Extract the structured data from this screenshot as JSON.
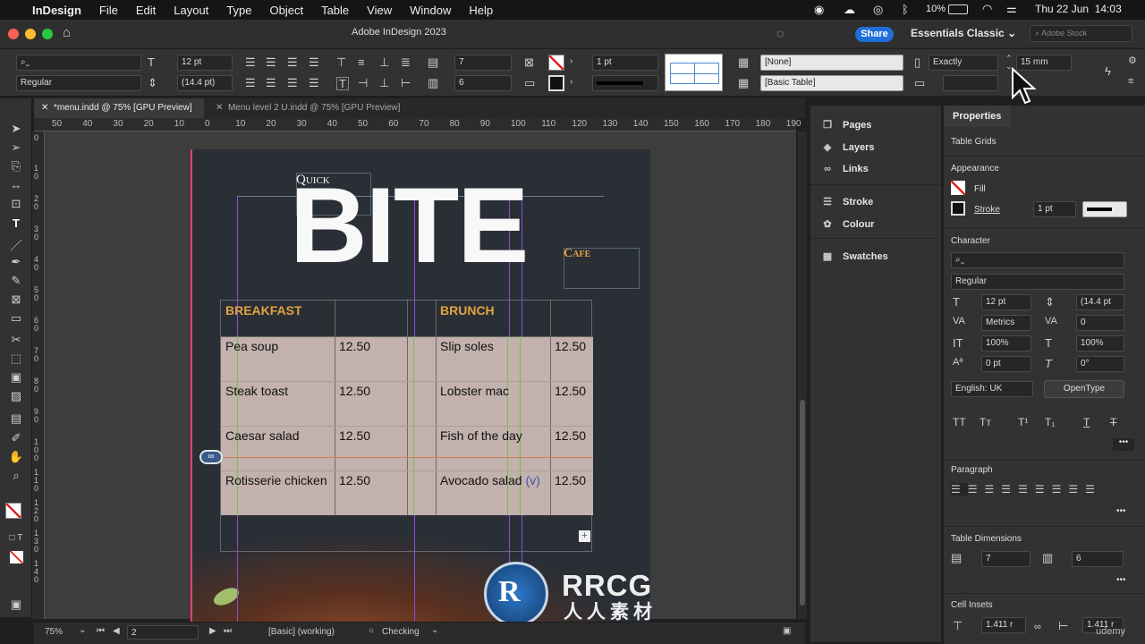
{
  "menubar": {
    "app": "InDesign",
    "items": [
      "File",
      "Edit",
      "Layout",
      "Type",
      "Object",
      "Table",
      "View",
      "Window",
      "Help"
    ],
    "battery": "10%",
    "datetime": "Thu 22 Jun  14:03"
  },
  "titlebar": {
    "title": "Adobe InDesign 2023",
    "share": "Share",
    "workspace": "Essentials Classic",
    "stock_placeholder": "Adobe Stock"
  },
  "control": {
    "font_size": "12 pt",
    "font_style": "Regular",
    "leading": "(14.4 pt)",
    "rows": "7",
    "cols": "6",
    "stroke_weight": "1 pt",
    "cell_style": "[None]",
    "table_style": "[Basic Table]",
    "row_height_mode": "Exactly",
    "row_height": "15 mm"
  },
  "tabs": [
    {
      "label": "*menu.indd @ 75% [GPU Preview]"
    },
    {
      "label": "Menu level 2 U.indd @ 75% [GPU Preview]"
    }
  ],
  "ruler_h": [
    "50",
    "40",
    "30",
    "20",
    "10",
    "0",
    "10",
    "20",
    "30",
    "40",
    "50",
    "60",
    "70",
    "80",
    "90",
    "100",
    "110",
    "120",
    "130",
    "140",
    "150",
    "160",
    "170",
    "180",
    "190"
  ],
  "ruler_v": [
    "0",
    "1\n0",
    "2\n0",
    "3\n0",
    "4\n0",
    "5\n0",
    "6\n0",
    "7\n0",
    "8\n0",
    "9\n0",
    "1\n0\n0",
    "1\n1\n0",
    "1\n2\n0",
    "1\n3\n0",
    "1\n4\n0"
  ],
  "document": {
    "quick": "Quick",
    "bite": "BITE",
    "cafe": "Cafe",
    "breakfast_header": "BREAKFAST",
    "brunch_header": "BRUNCH",
    "rows": [
      {
        "item1": "Pea soup",
        "price1": "12.50",
        "item2": "Slip soles",
        "price2": "12.50",
        "tag2": ""
      },
      {
        "item1": "Steak toast",
        "price1": "12.50",
        "item2": "Lobster mac",
        "price2": "12.50",
        "tag2": ""
      },
      {
        "item1": "Caesar salad",
        "price1": "12.50",
        "item2": "Fish of the day",
        "price2": "12.50",
        "tag2": ""
      },
      {
        "item1": "Rotisserie chicken",
        "price1": "12.50",
        "item2": "Avocado salad",
        "price2": "12.50",
        "tag2": "(v)"
      }
    ],
    "header_color": "#e0a341",
    "cell_fill": "#c2b1ac",
    "page_bg": "#2a2f36"
  },
  "statusbar": {
    "zoom": "75%",
    "page": "2",
    "style": "[Basic] (working)",
    "preflight": "Checking"
  },
  "panels_left": {
    "items": [
      "Pages",
      "Layers",
      "Links",
      "Stroke",
      "Colour",
      "Swatches"
    ]
  },
  "properties": {
    "tab": "Properties",
    "context": "Table Grids",
    "appearance": "Appearance",
    "fill": "Fill",
    "stroke": "Stroke",
    "stroke_weight": "1 pt",
    "character": "Character",
    "font_style": "Regular",
    "size": "12 pt",
    "leading": "(14.4 pt",
    "kerning": "Metrics",
    "tracking": "0",
    "vscale": "100%",
    "hscale": "100%",
    "baseline": "0 pt",
    "skew": "0°",
    "language": "English: UK",
    "opentype": "OpenType",
    "paragraph": "Paragraph",
    "table_dimensions": "Table Dimensions",
    "rows": "7",
    "cols": "6",
    "cell_insets": "Cell Insets",
    "inset1": "1.411 r",
    "inset2": "1.411 r",
    "udemy": "udemy"
  },
  "watermark": {
    "brand": "RRCG",
    "sub": "人人素材"
  }
}
